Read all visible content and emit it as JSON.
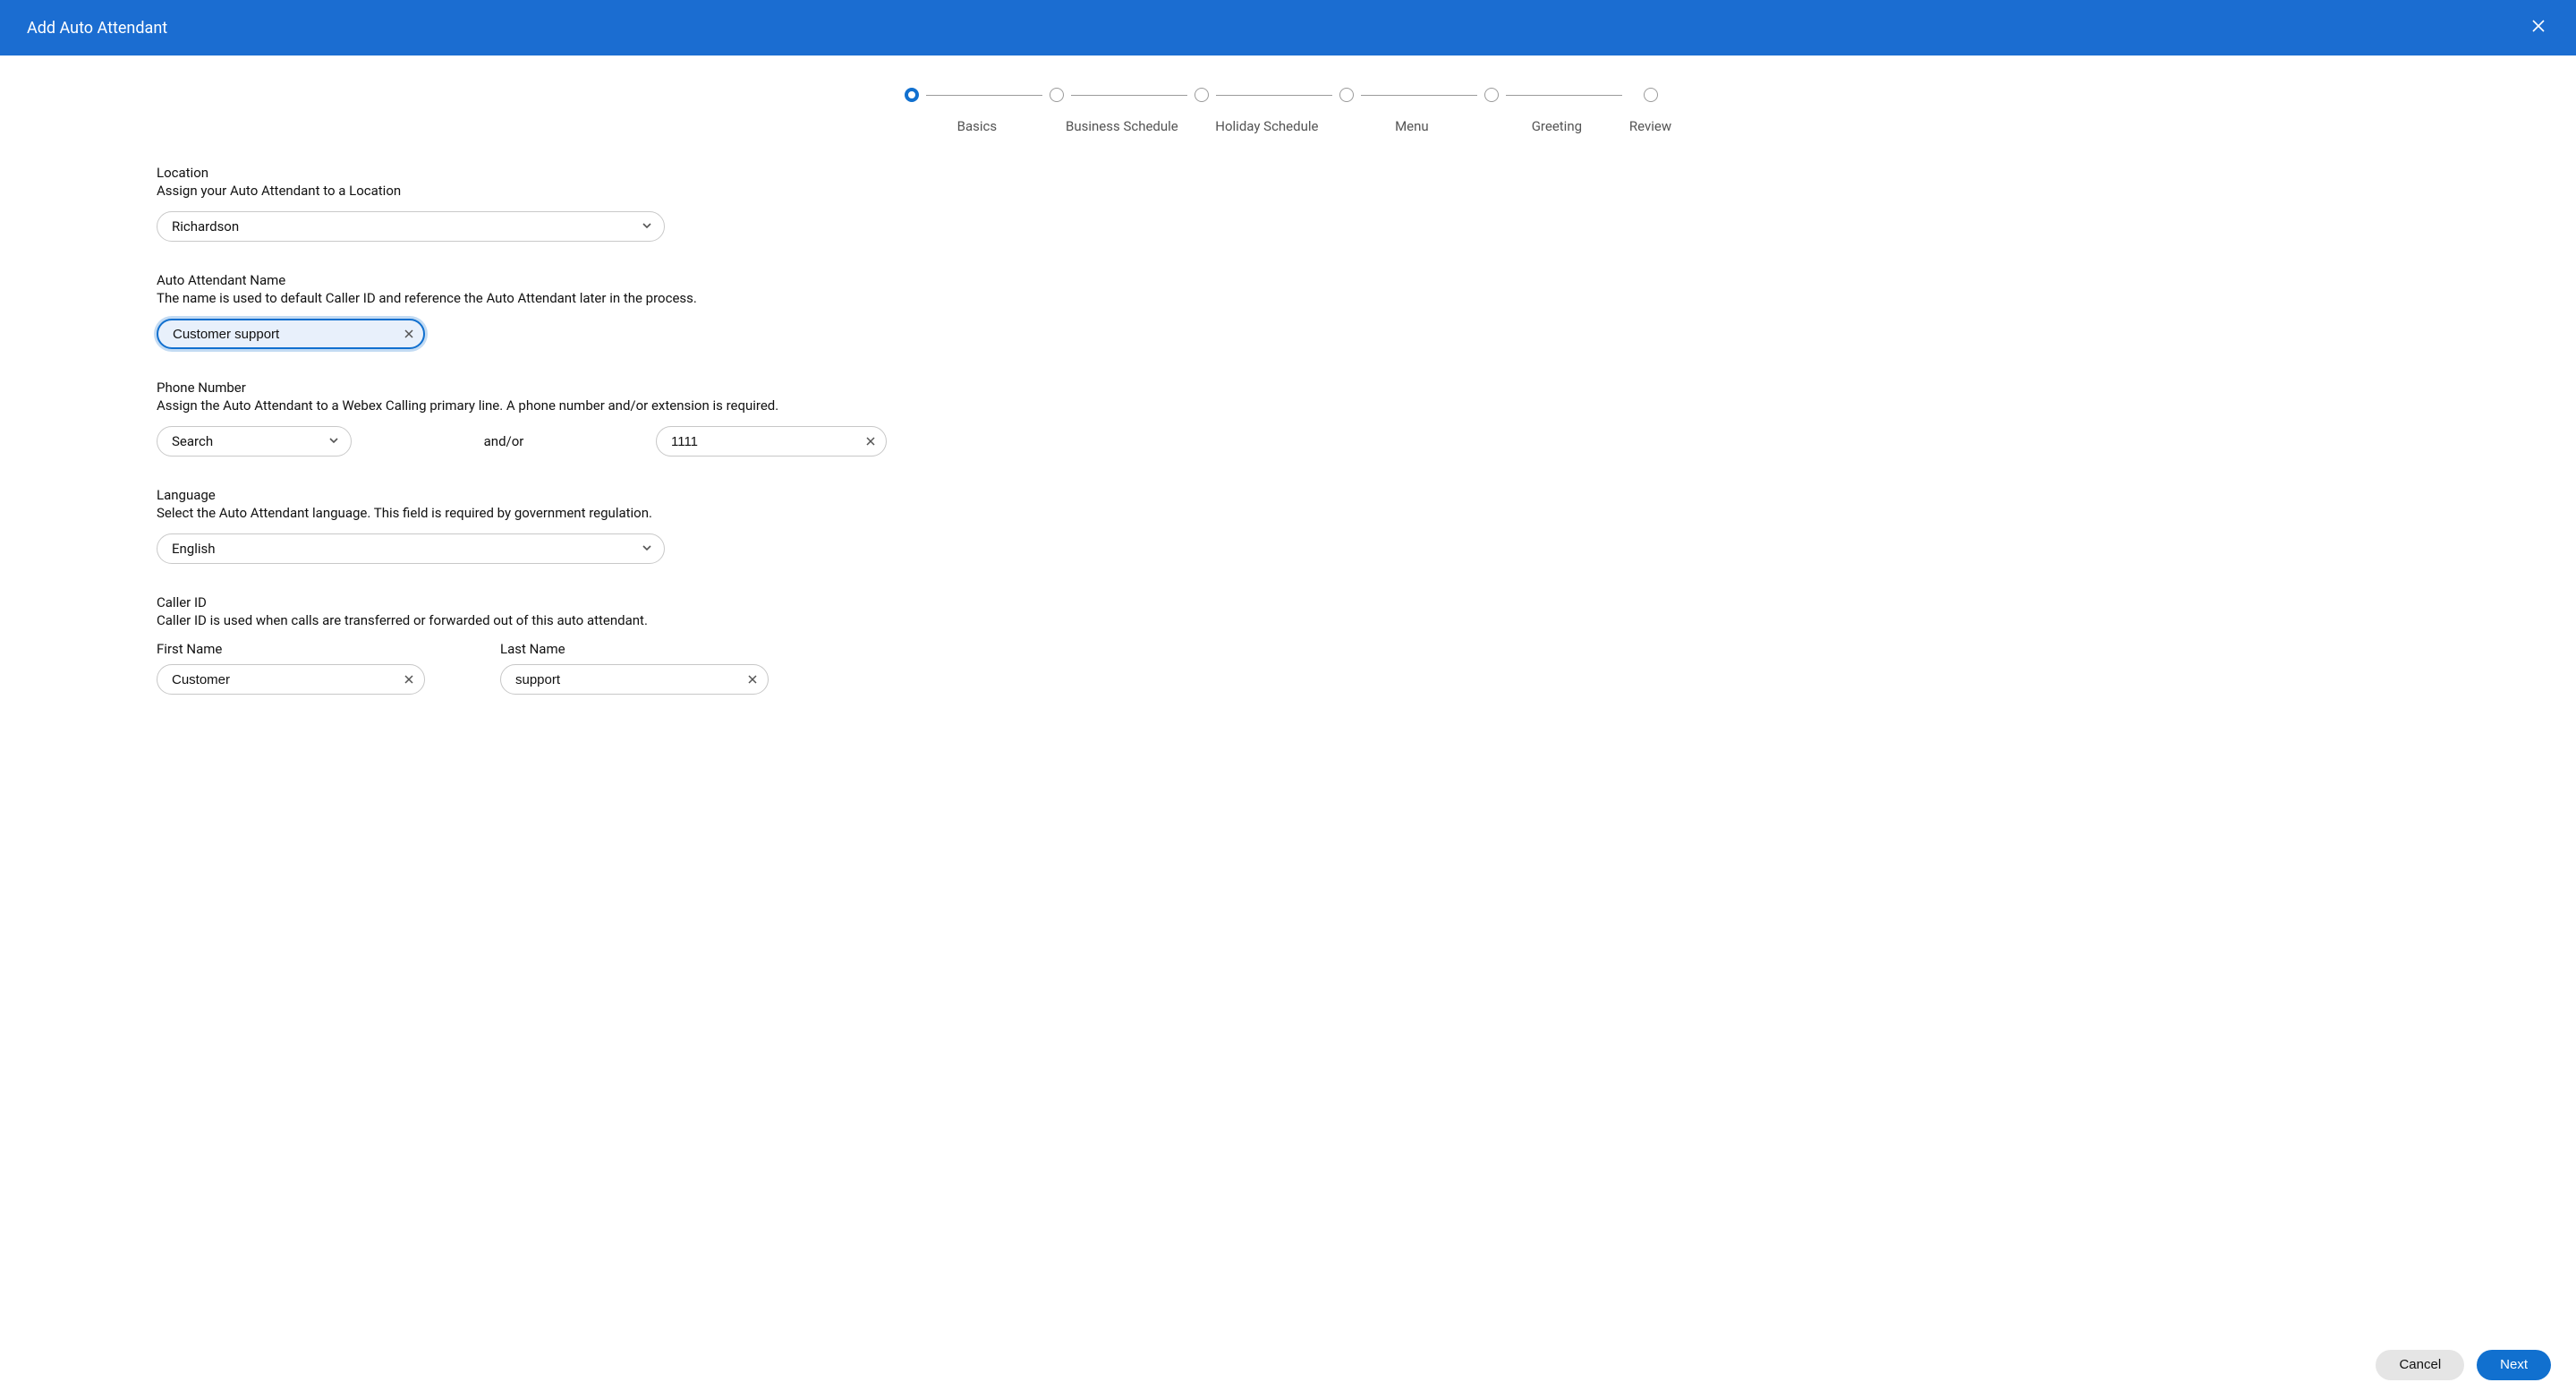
{
  "header": {
    "title": "Add Auto Attendant"
  },
  "stepper": {
    "steps": [
      {
        "label": "Basics"
      },
      {
        "label": "Business Schedule"
      },
      {
        "label": "Holiday Schedule"
      },
      {
        "label": "Menu"
      },
      {
        "label": "Greeting"
      },
      {
        "label": "Review"
      }
    ]
  },
  "form": {
    "location": {
      "title": "Location",
      "desc": "Assign your Auto Attendant to a Location",
      "value": "Richardson"
    },
    "name": {
      "title": "Auto Attendant Name",
      "desc": "The name is used to default Caller ID and reference the Auto Attendant later in the process.",
      "value": "Customer support"
    },
    "phone": {
      "title": "Phone Number",
      "desc": "Assign the Auto Attendant to a Webex Calling primary line. A phone number and/or extension is required.",
      "search_placeholder": "Search",
      "andor": "and/or",
      "extension_value": "1111"
    },
    "language": {
      "title": "Language",
      "desc": "Select the Auto Attendant language. This field is required by government regulation.",
      "value": "English"
    },
    "caller_id": {
      "title": "Caller ID",
      "desc": "Caller ID is used when calls are transferred or forwarded out of this auto attendant.",
      "first_label": "First Name",
      "first_value": "Customer",
      "last_label": "Last Name",
      "last_value": "support"
    }
  },
  "footer": {
    "cancel": "Cancel",
    "next": "Next"
  }
}
